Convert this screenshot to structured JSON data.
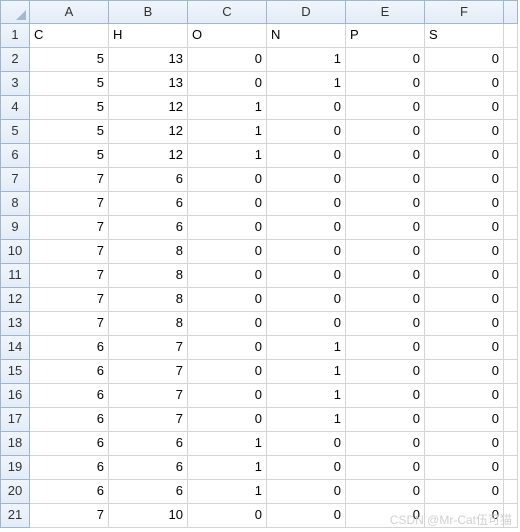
{
  "columns": [
    "A",
    "B",
    "C",
    "D",
    "E",
    "F"
  ],
  "rows": [
    {
      "n": 1,
      "align": "left",
      "cells": [
        "C",
        "H",
        "O",
        "N",
        "P",
        "S"
      ]
    },
    {
      "n": 2,
      "align": "right",
      "cells": [
        "5",
        "13",
        "0",
        "1",
        "0",
        "0"
      ]
    },
    {
      "n": 3,
      "align": "right",
      "cells": [
        "5",
        "13",
        "0",
        "1",
        "0",
        "0"
      ]
    },
    {
      "n": 4,
      "align": "right",
      "cells": [
        "5",
        "12",
        "1",
        "0",
        "0",
        "0"
      ]
    },
    {
      "n": 5,
      "align": "right",
      "cells": [
        "5",
        "12",
        "1",
        "0",
        "0",
        "0"
      ]
    },
    {
      "n": 6,
      "align": "right",
      "cells": [
        "5",
        "12",
        "1",
        "0",
        "0",
        "0"
      ]
    },
    {
      "n": 7,
      "align": "right",
      "cells": [
        "7",
        "6",
        "0",
        "0",
        "0",
        "0"
      ]
    },
    {
      "n": 8,
      "align": "right",
      "cells": [
        "7",
        "6",
        "0",
        "0",
        "0",
        "0"
      ]
    },
    {
      "n": 9,
      "align": "right",
      "cells": [
        "7",
        "6",
        "0",
        "0",
        "0",
        "0"
      ]
    },
    {
      "n": 10,
      "align": "right",
      "cells": [
        "7",
        "8",
        "0",
        "0",
        "0",
        "0"
      ]
    },
    {
      "n": 11,
      "align": "right",
      "cells": [
        "7",
        "8",
        "0",
        "0",
        "0",
        "0"
      ]
    },
    {
      "n": 12,
      "align": "right",
      "cells": [
        "7",
        "8",
        "0",
        "0",
        "0",
        "0"
      ]
    },
    {
      "n": 13,
      "align": "right",
      "cells": [
        "7",
        "8",
        "0",
        "0",
        "0",
        "0"
      ]
    },
    {
      "n": 14,
      "align": "right",
      "cells": [
        "6",
        "7",
        "0",
        "1",
        "0",
        "0"
      ]
    },
    {
      "n": 15,
      "align": "right",
      "cells": [
        "6",
        "7",
        "0",
        "1",
        "0",
        "0"
      ]
    },
    {
      "n": 16,
      "align": "right",
      "cells": [
        "6",
        "7",
        "0",
        "1",
        "0",
        "0"
      ]
    },
    {
      "n": 17,
      "align": "right",
      "cells": [
        "6",
        "7",
        "0",
        "1",
        "0",
        "0"
      ]
    },
    {
      "n": 18,
      "align": "right",
      "cells": [
        "6",
        "6",
        "1",
        "0",
        "0",
        "0"
      ]
    },
    {
      "n": 19,
      "align": "right",
      "cells": [
        "6",
        "6",
        "1",
        "0",
        "0",
        "0"
      ]
    },
    {
      "n": 20,
      "align": "right",
      "cells": [
        "6",
        "6",
        "1",
        "0",
        "0",
        "0"
      ]
    },
    {
      "n": 21,
      "align": "right",
      "cells": [
        "7",
        "10",
        "0",
        "0",
        "0",
        "0"
      ]
    }
  ],
  "watermark": "CSDN @Mr-Cat伍可猫"
}
